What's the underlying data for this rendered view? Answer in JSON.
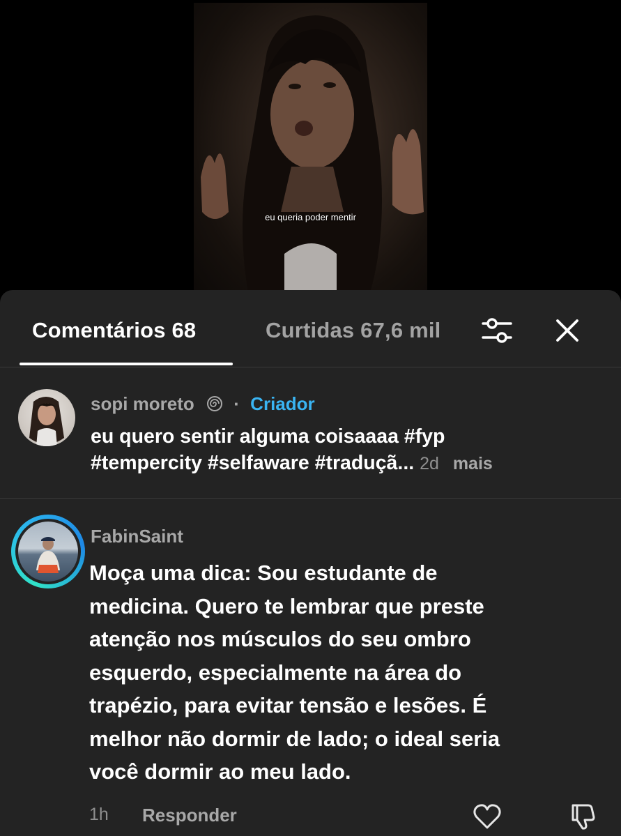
{
  "video": {
    "caption": "eu queria poder mentir"
  },
  "tabs": {
    "comments_label": "Comentários 68",
    "likes_label": "Curtidas 67,6 mil",
    "filter_icon": "sliders-icon",
    "close_icon": "close-icon"
  },
  "creator_comment": {
    "username": "sopi moreto",
    "badge_icon": "spiral-icon",
    "separator": "·",
    "role": "Criador",
    "line1": "eu quero sentir alguma coisaaaa #fyp",
    "line2": "#tempercity #selfaware #traduçã...",
    "time": "2d",
    "more": "mais"
  },
  "comment": {
    "username": "FabinSaint",
    "lines": [
      "Moça uma dica: Sou estudante de",
      "medicina. Quero te lembrar que preste",
      "atenção nos músculos do seu ombro",
      "esquerdo, especialmente na área do",
      "trapézio, para evitar tensão e lesões. É",
      "melhor não dormir de lado; o ideal seria",
      "você dormir ao meu lado."
    ],
    "time": "1h",
    "reply": "Responder",
    "like_icon": "heart-icon",
    "dislike_icon": "thumbs-down-icon"
  },
  "colors": {
    "sheet_bg": "#232323",
    "creator_accent": "#3ab4f2",
    "muted_text": "#a8a8a8"
  }
}
